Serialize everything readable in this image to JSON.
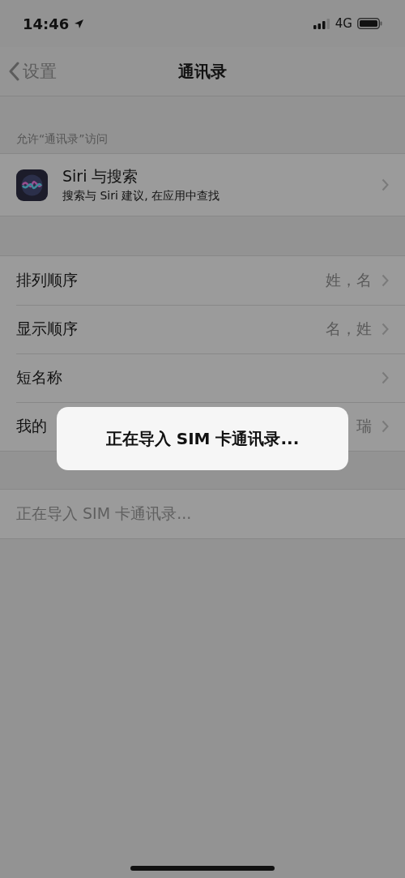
{
  "status_bar": {
    "time": "14:46",
    "network": "4G"
  },
  "nav_bar": {
    "back": "设置",
    "title": "通讯录"
  },
  "section_header": "允许“通讯录”访问",
  "siri_row": {
    "title": "Siri 与搜索",
    "subtitle": "搜索与 Siri 建议, 在应用中查找"
  },
  "settings": [
    {
      "label": "排列顺序",
      "value": "姓，名"
    },
    {
      "label": "显示顺序",
      "value": "名，姓"
    },
    {
      "label": "短名称"
    },
    {
      "label": "我的",
      "value": "瑞"
    }
  ],
  "import_row": {
    "label": "正在导入 SIM 卡通讯录...",
    "disabled": true
  },
  "hud": {
    "message": "正在导入 SIM 卡通讯录..."
  }
}
